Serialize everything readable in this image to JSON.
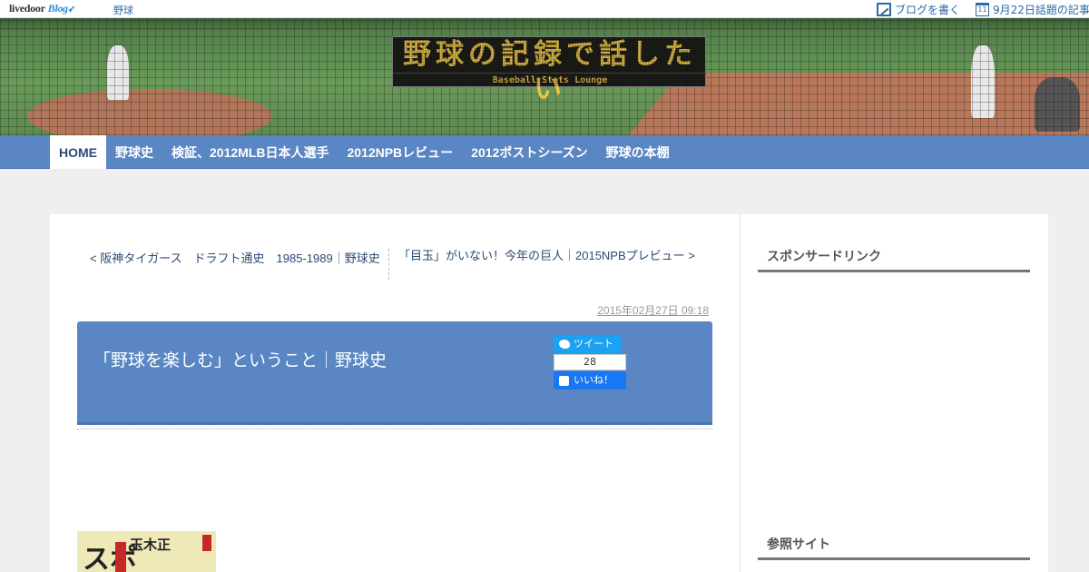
{
  "topbar": {
    "logo_brand": "livedoor",
    "logo_blog": "Blog",
    "category": "野球",
    "write_label": "ブログを書く",
    "calendar_day": "11",
    "topic_label": "9月22日話題の記事"
  },
  "header": {
    "site_title": "野球の記録で話したい",
    "site_subtitle": "Baseball Stats Lounge"
  },
  "nav": {
    "items": [
      {
        "label": "HOME",
        "active": true
      },
      {
        "label": "野球史"
      },
      {
        "label": "検証、2012MLB日本人選手"
      },
      {
        "label": "2012NPBレビュー"
      },
      {
        "label": "2012ポストシーズン"
      },
      {
        "label": "野球の本棚"
      }
    ]
  },
  "article": {
    "prev_link": "< 阪神タイガース　ドラフト通史　1985-1989｜野球史",
    "next_link": "「目玉」がいない！今年の巨人｜2015NPBプレビュー >",
    "datetime": "2015年02月27日 09:18",
    "title": "「野球を楽しむ」ということ｜野球史",
    "tweet_label": "ツイート",
    "like_count": "28",
    "like_label": "いいね！"
  },
  "book": {
    "big_char": "スポ",
    "author": "玉木正"
  },
  "sidebar": {
    "sponsor_heading": "スポンサードリンク",
    "reference_heading": "参照サイト"
  },
  "colors": {
    "accent": "#5a86c3",
    "link": "#2c4a75",
    "twitter": "#1da1f2",
    "facebook": "#1877f2"
  }
}
